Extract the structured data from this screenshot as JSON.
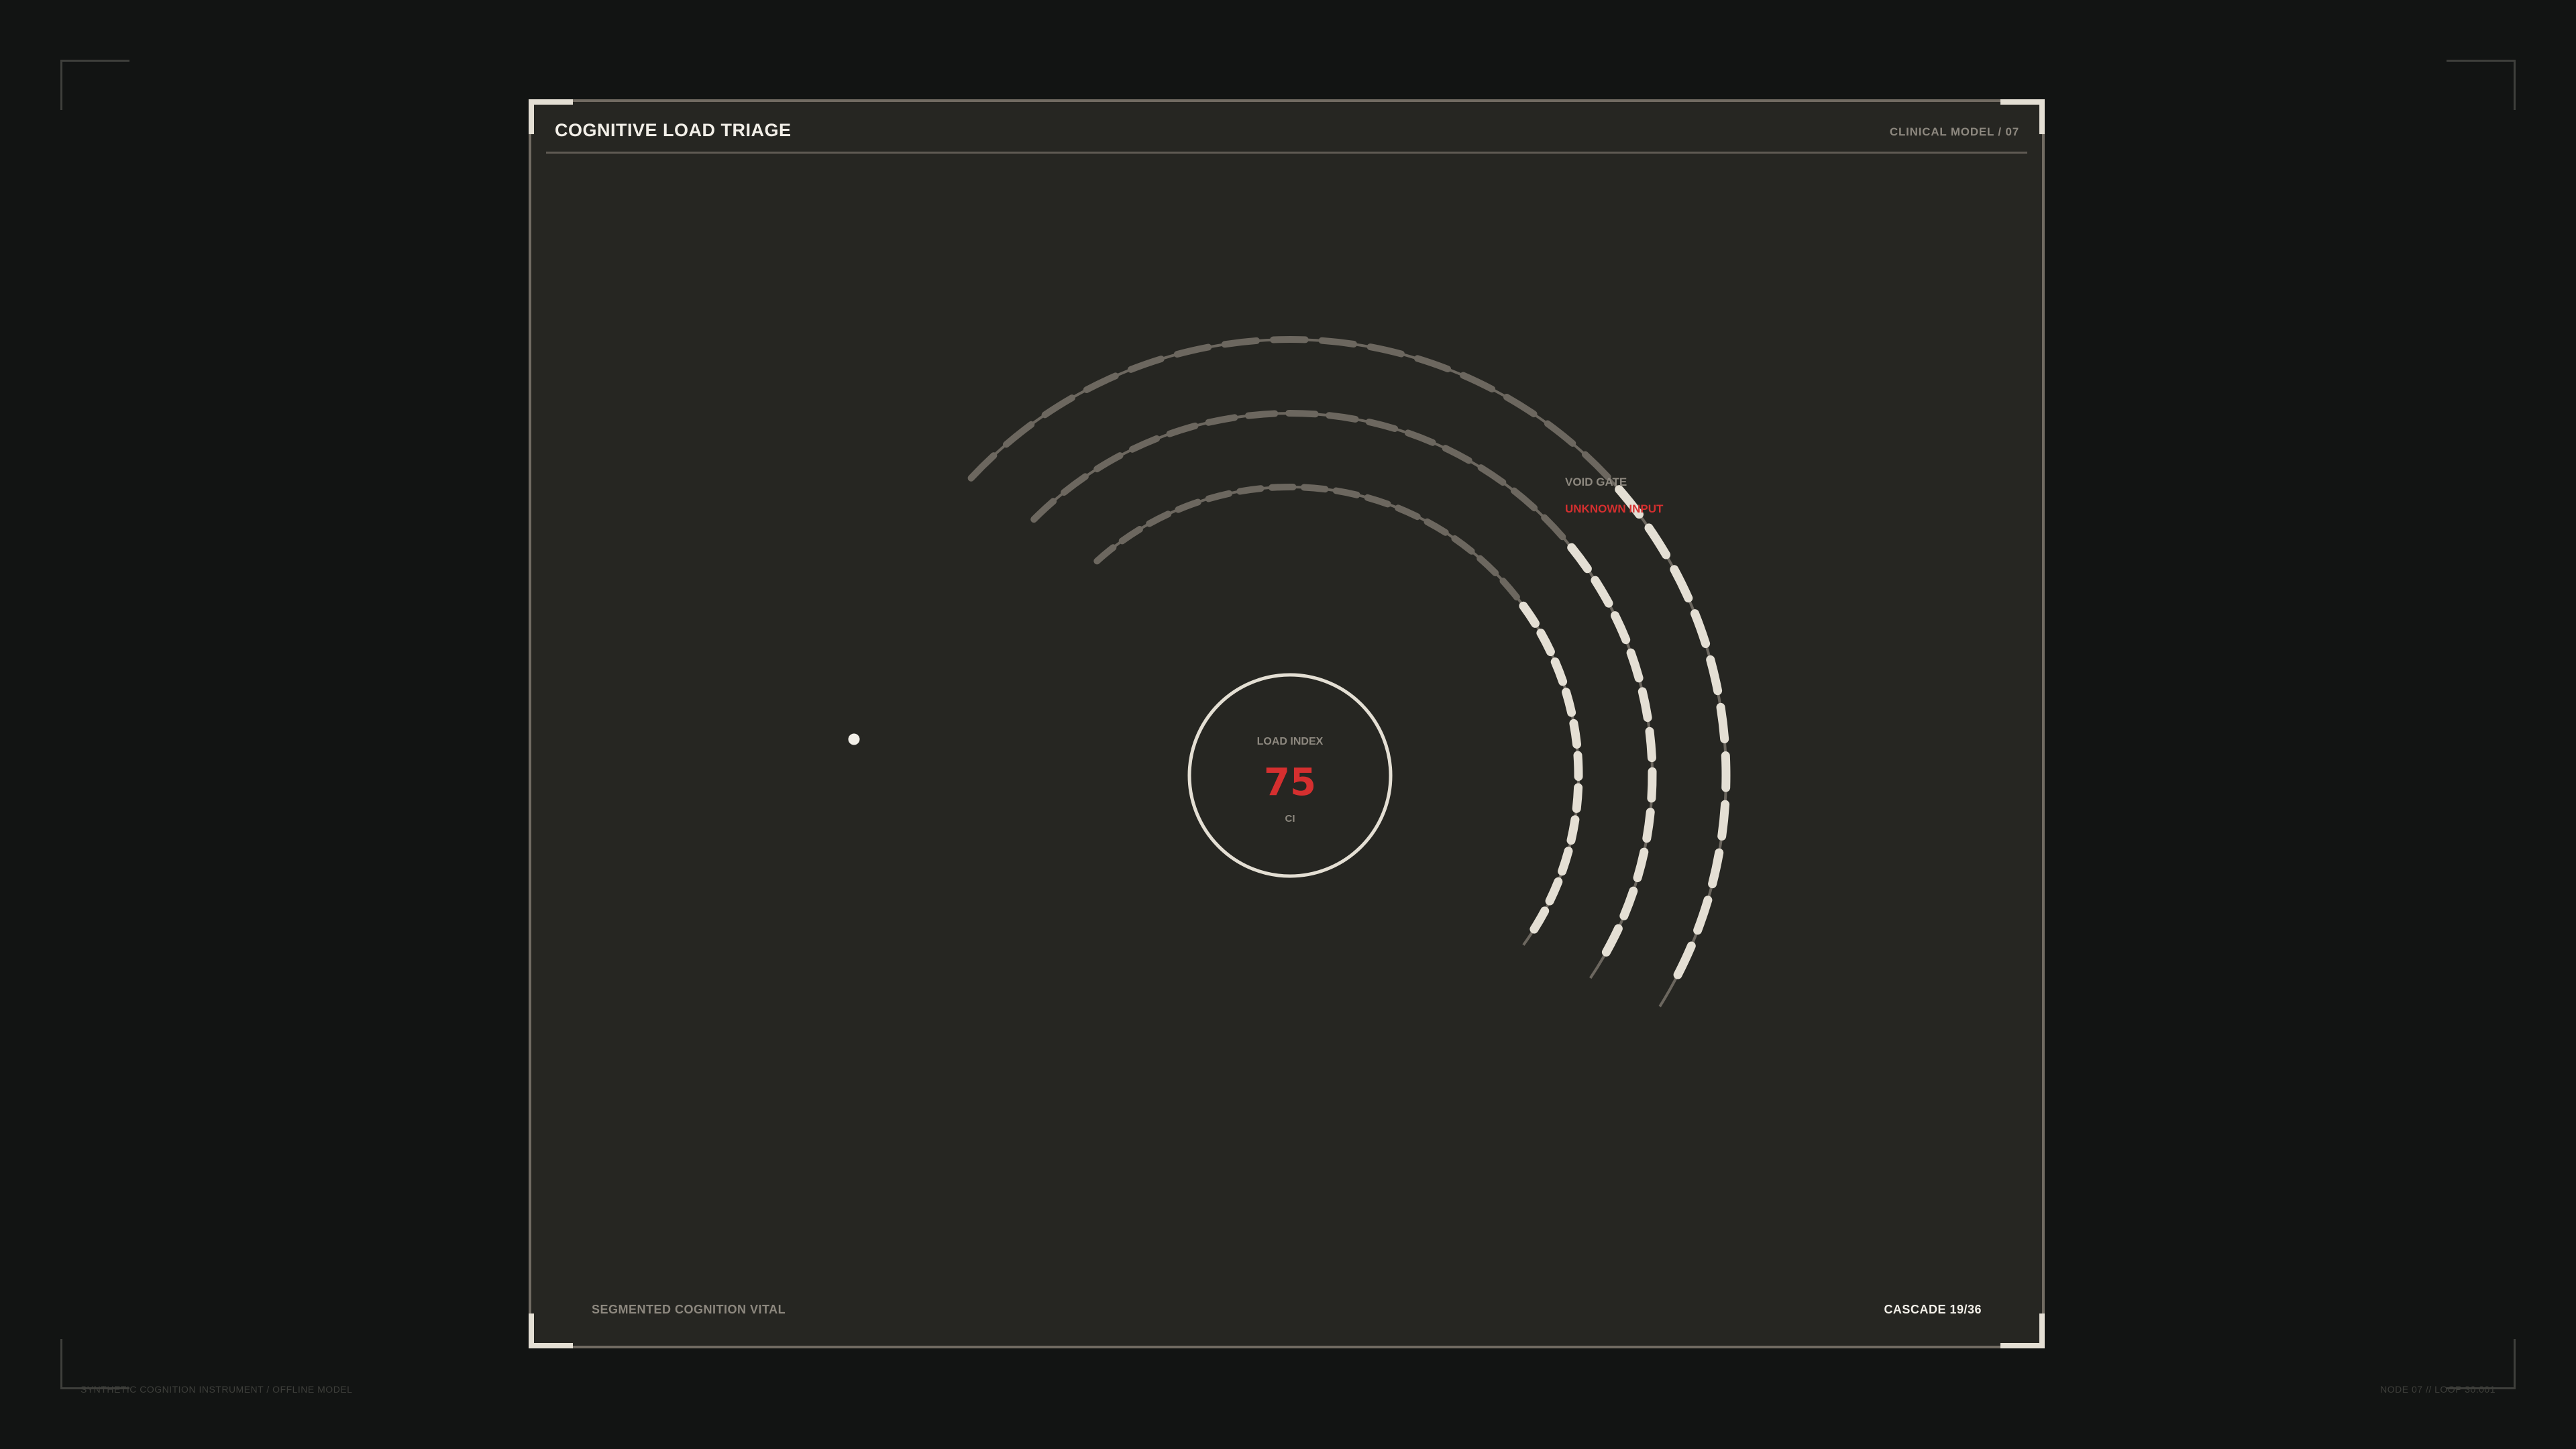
{
  "header": {
    "title": "COGNITIVE LOAD TRIAGE",
    "meta": "CLINICAL MODEL / 07"
  },
  "gauge": {
    "center_label": "LOAD INDEX",
    "value": "75",
    "unit": "CI",
    "annotation_title": "VOID GATE",
    "annotation_status": "UNKNOWN INPUT",
    "rings": [
      {
        "name": "outer",
        "fill_fraction": 0.42
      },
      {
        "name": "middle",
        "fill_fraction": 0.42
      },
      {
        "name": "inner",
        "fill_fraction": 0.42
      }
    ]
  },
  "footer": {
    "label": "SEGMENTED COGNITION VITAL",
    "counter": "CASCADE 19/36"
  },
  "outer_footer": {
    "left": "SYNTHETIC COGNITION INSTRUMENT / OFFLINE MODEL",
    "right": "NODE 07 // LOOP 30.001"
  },
  "colors": {
    "background": "#121413",
    "panel": "#262622",
    "active_segment": "#e4dfd4",
    "inactive_segment": "#6c675f",
    "alert": "#d52f2f"
  }
}
